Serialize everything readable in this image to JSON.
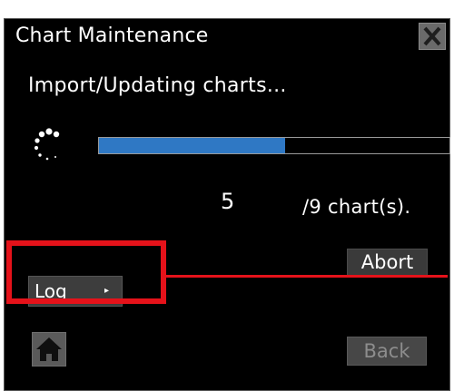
{
  "window": {
    "title": "Chart Maintenance",
    "close_icon": "close-icon"
  },
  "status": {
    "message": "Import/Updating charts..."
  },
  "progress": {
    "fraction": 0.53,
    "fill_color": "#2f78c4",
    "current": "5",
    "total_label": "/9 chart(s)."
  },
  "buttons": {
    "abort": "Abort",
    "log": "Log",
    "log_arrow": "▸",
    "home_icon": "home-icon",
    "back": "Back"
  },
  "highlight": {
    "color": "#e5121a"
  }
}
